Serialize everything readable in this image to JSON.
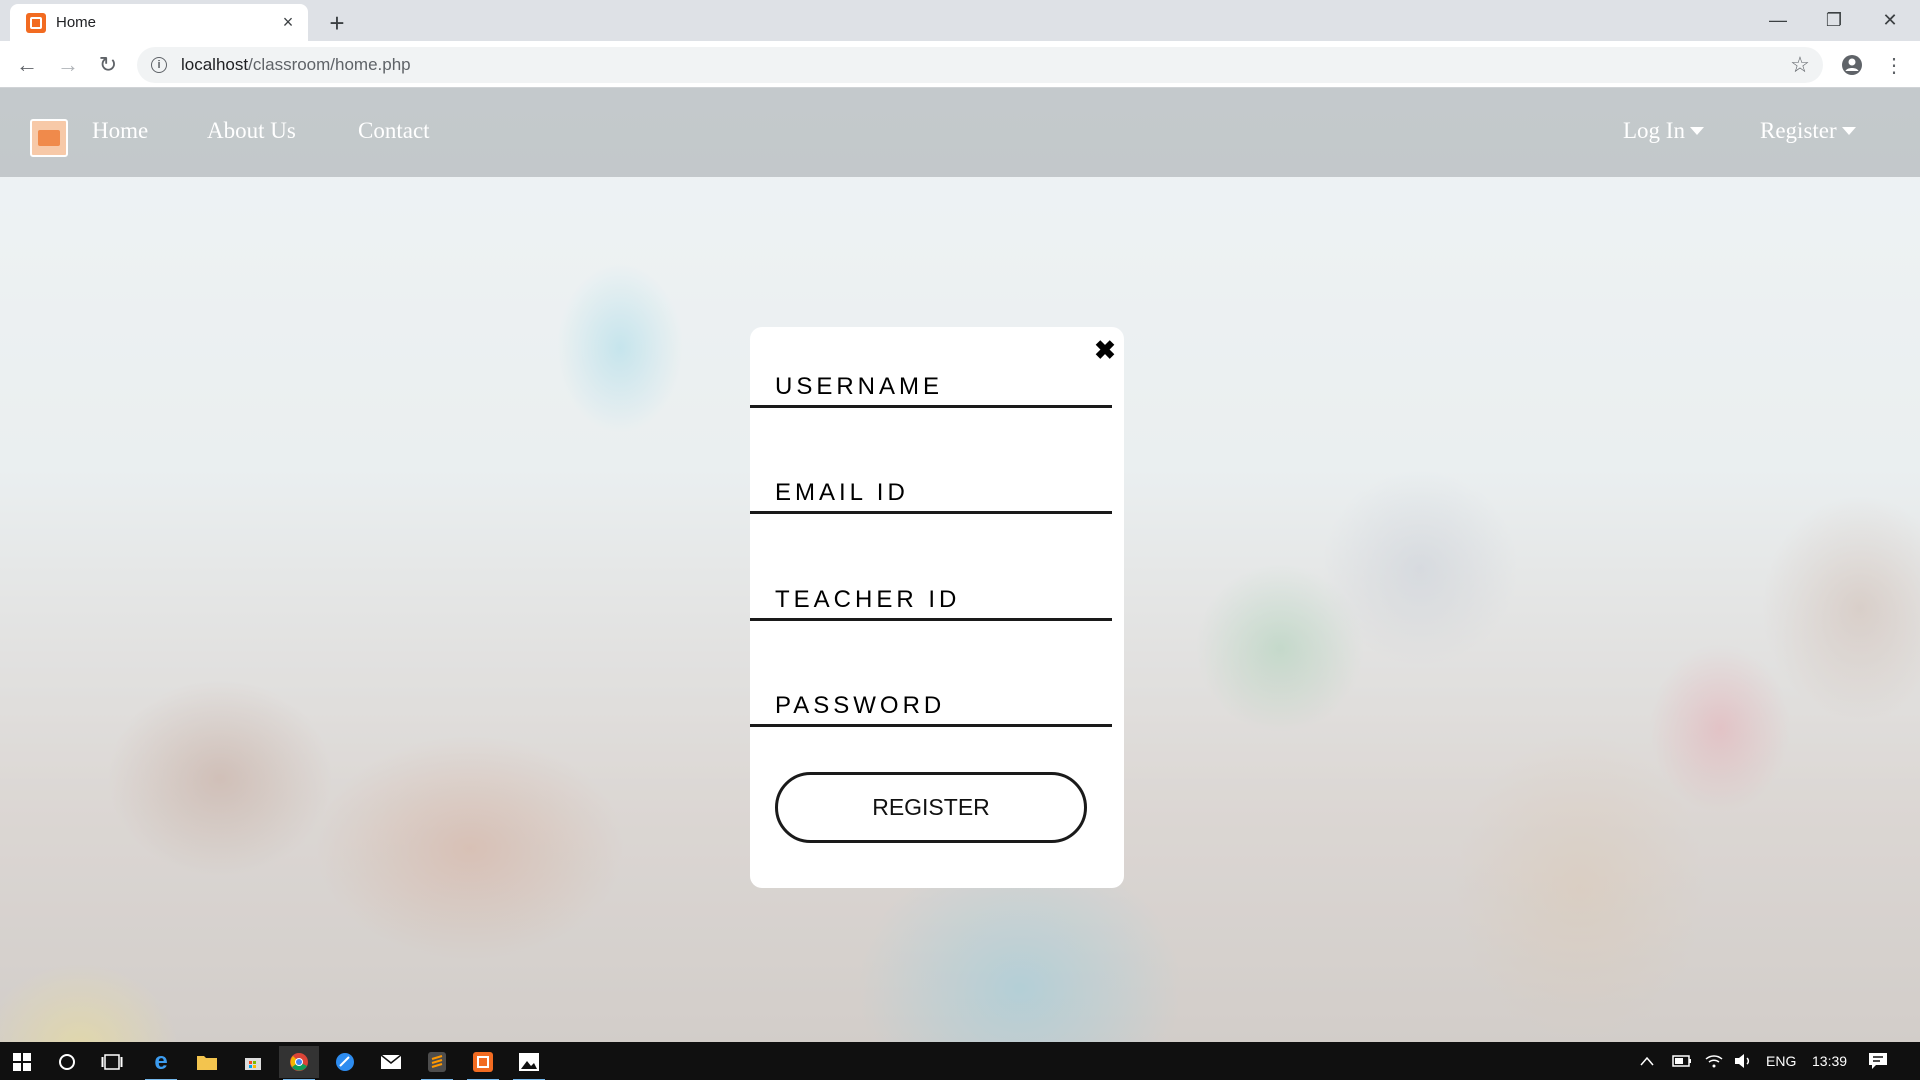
{
  "browser": {
    "tab_title": "Home",
    "tab_close": "×",
    "new_tab": "+",
    "url_host": "localhost",
    "url_path": "/classroom/home.php",
    "window_controls": {
      "minimize": "—",
      "maximize": "❐",
      "close": "✕"
    },
    "nav": {
      "back": "←",
      "forward": "→",
      "reload": "↻"
    }
  },
  "site_nav": {
    "links": [
      "Home",
      "About Us",
      "Contact"
    ],
    "login": "Log In",
    "register": "Register"
  },
  "modal": {
    "close": "✖",
    "fields": {
      "username": "USERNAME",
      "email": "EMAIL ID",
      "teacher_id": "TEACHER ID",
      "password": "PASSWORD"
    },
    "submit": "REGISTER"
  },
  "taskbar": {
    "language": "ENG",
    "time": "13:39"
  },
  "colors": {
    "brand": "#f26b21",
    "active_indicator": "#76b9ed"
  }
}
